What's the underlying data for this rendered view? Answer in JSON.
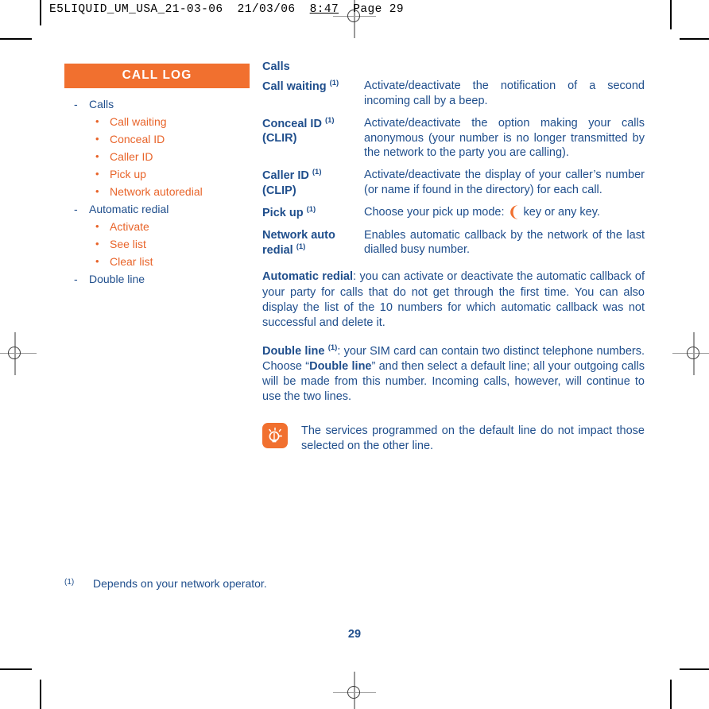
{
  "running_header": {
    "filename": "E5LIQUID_UM_USA_21-03-06",
    "date": "21/03/06",
    "time": "8:47",
    "page_label": "Page 29"
  },
  "sidebar": {
    "banner": "CALL LOG",
    "items": [
      {
        "level": 1,
        "marker": "-",
        "label": "Calls"
      },
      {
        "level": 2,
        "marker": "•",
        "label": "Call waiting"
      },
      {
        "level": 2,
        "marker": "•",
        "label": "Conceal ID"
      },
      {
        "level": 2,
        "marker": "•",
        "label": "Caller ID"
      },
      {
        "level": 2,
        "marker": "•",
        "label": "Pick up"
      },
      {
        "level": 2,
        "marker": "•",
        "label": "Network autoredial"
      },
      {
        "level": 1,
        "marker": "-",
        "label": "Automatic redial"
      },
      {
        "level": 2,
        "marker": "•",
        "label": "Activate"
      },
      {
        "level": 2,
        "marker": "•",
        "label": "See list"
      },
      {
        "level": 2,
        "marker": "•",
        "label": "Clear list"
      },
      {
        "level": 1,
        "marker": "-",
        "label": "Double line"
      }
    ]
  },
  "main": {
    "section_title": "Calls",
    "definitions": [
      {
        "term": "Call waiting",
        "term_footnote": "(1)",
        "term_second_line": "",
        "description": "Activate/deactivate the notification of a second incoming call by a beep."
      },
      {
        "term": "Conceal ID",
        "term_footnote": "(1)",
        "term_second_line": "(CLIR)",
        "description": "Activate/deactivate the option making your calls anonymous (your number is no longer transmitted by the network to the party you are calling)."
      },
      {
        "term": "Caller ID",
        "term_footnote": "(1)",
        "term_second_line": "(CLIP)",
        "description": "Activate/deactivate the display of your caller’s number (or name if found in the directory) for each call."
      },
      {
        "term": "Pick up",
        "term_footnote": "(1)",
        "term_second_line": "",
        "description_before_icon": "Choose your pick up mode:",
        "icon": "phone-call-key-icon",
        "icon_glyph": "❨",
        "description_after_icon": "key or any key."
      },
      {
        "term": "Network auto",
        "term_footnote": "",
        "term_second_line": "redial",
        "term_second_line_footnote": "(1)",
        "description": "Enables automatic callback by the network of the last dialled busy number."
      }
    ],
    "paragraphs": [
      {
        "lead": "Automatic redial",
        "lead_footnote": "",
        "text": ": you can activate or deactivate the automatic callback of your party for calls that do not get through the first time. You can also display the list of the 10 numbers for which automatic callback was not successful and delete it."
      },
      {
        "lead": "Double line",
        "lead_footnote": "(1)",
        "text_part1": ": your SIM card can contain two distinct telephone numbers. Choose “",
        "inline_bold": "Double line",
        "text_part2": "” and then select a default line; all your outgoing calls will be made from this number. Incoming calls, however, will continue to use the two lines."
      }
    ],
    "note": {
      "icon": "lightbulb-tip-icon",
      "text": "The services programmed on the default line do not impact those selected on the other line."
    }
  },
  "footnote": {
    "mark": "(1)",
    "text": "Depends on your network operator."
  },
  "folio": "29",
  "colors": {
    "orange": "#F1702F",
    "orange_text": "#E8642A",
    "blue": "#1F4E8C"
  }
}
